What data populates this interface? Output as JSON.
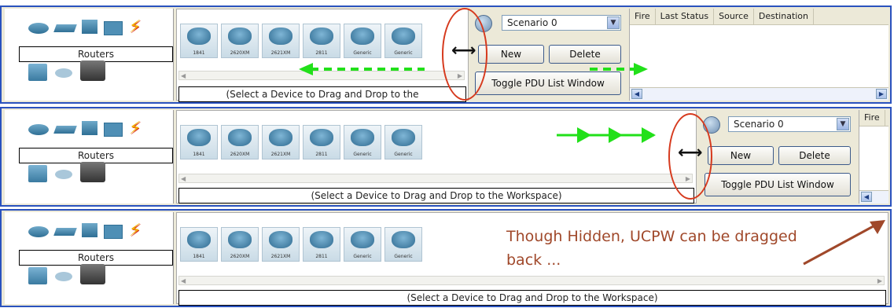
{
  "device_panel": {
    "category_label": "Routers",
    "status_partial": "(Select a Device to Drag and Drop to the",
    "status_full": "(Select a Device to Drag and Drop to the Workspace)",
    "devices": [
      "1841",
      "2620XM",
      "2621XM",
      "2811",
      "Generic",
      "Generic"
    ]
  },
  "category_icons": [
    "router-icon",
    "switch-icon",
    "hub-icon",
    "wireless-icon",
    "connection-icon",
    "end-device-icon",
    "wan-emulation-icon",
    "multiuser-icon"
  ],
  "scenario": {
    "selected": "Scenario 0",
    "new_label": "New",
    "delete_label": "Delete",
    "toggle_label": "Toggle PDU List Window"
  },
  "pdu_table": {
    "columns": [
      "Fire",
      "Last Status",
      "Source",
      "Destination"
    ]
  },
  "annotation": {
    "line1": "Though Hidden, UCPW can be dragged",
    "line2": "back ...",
    "arrow_color": "#22e01a",
    "oval_color": "#d63a1e",
    "note_color": "#a0482a"
  }
}
